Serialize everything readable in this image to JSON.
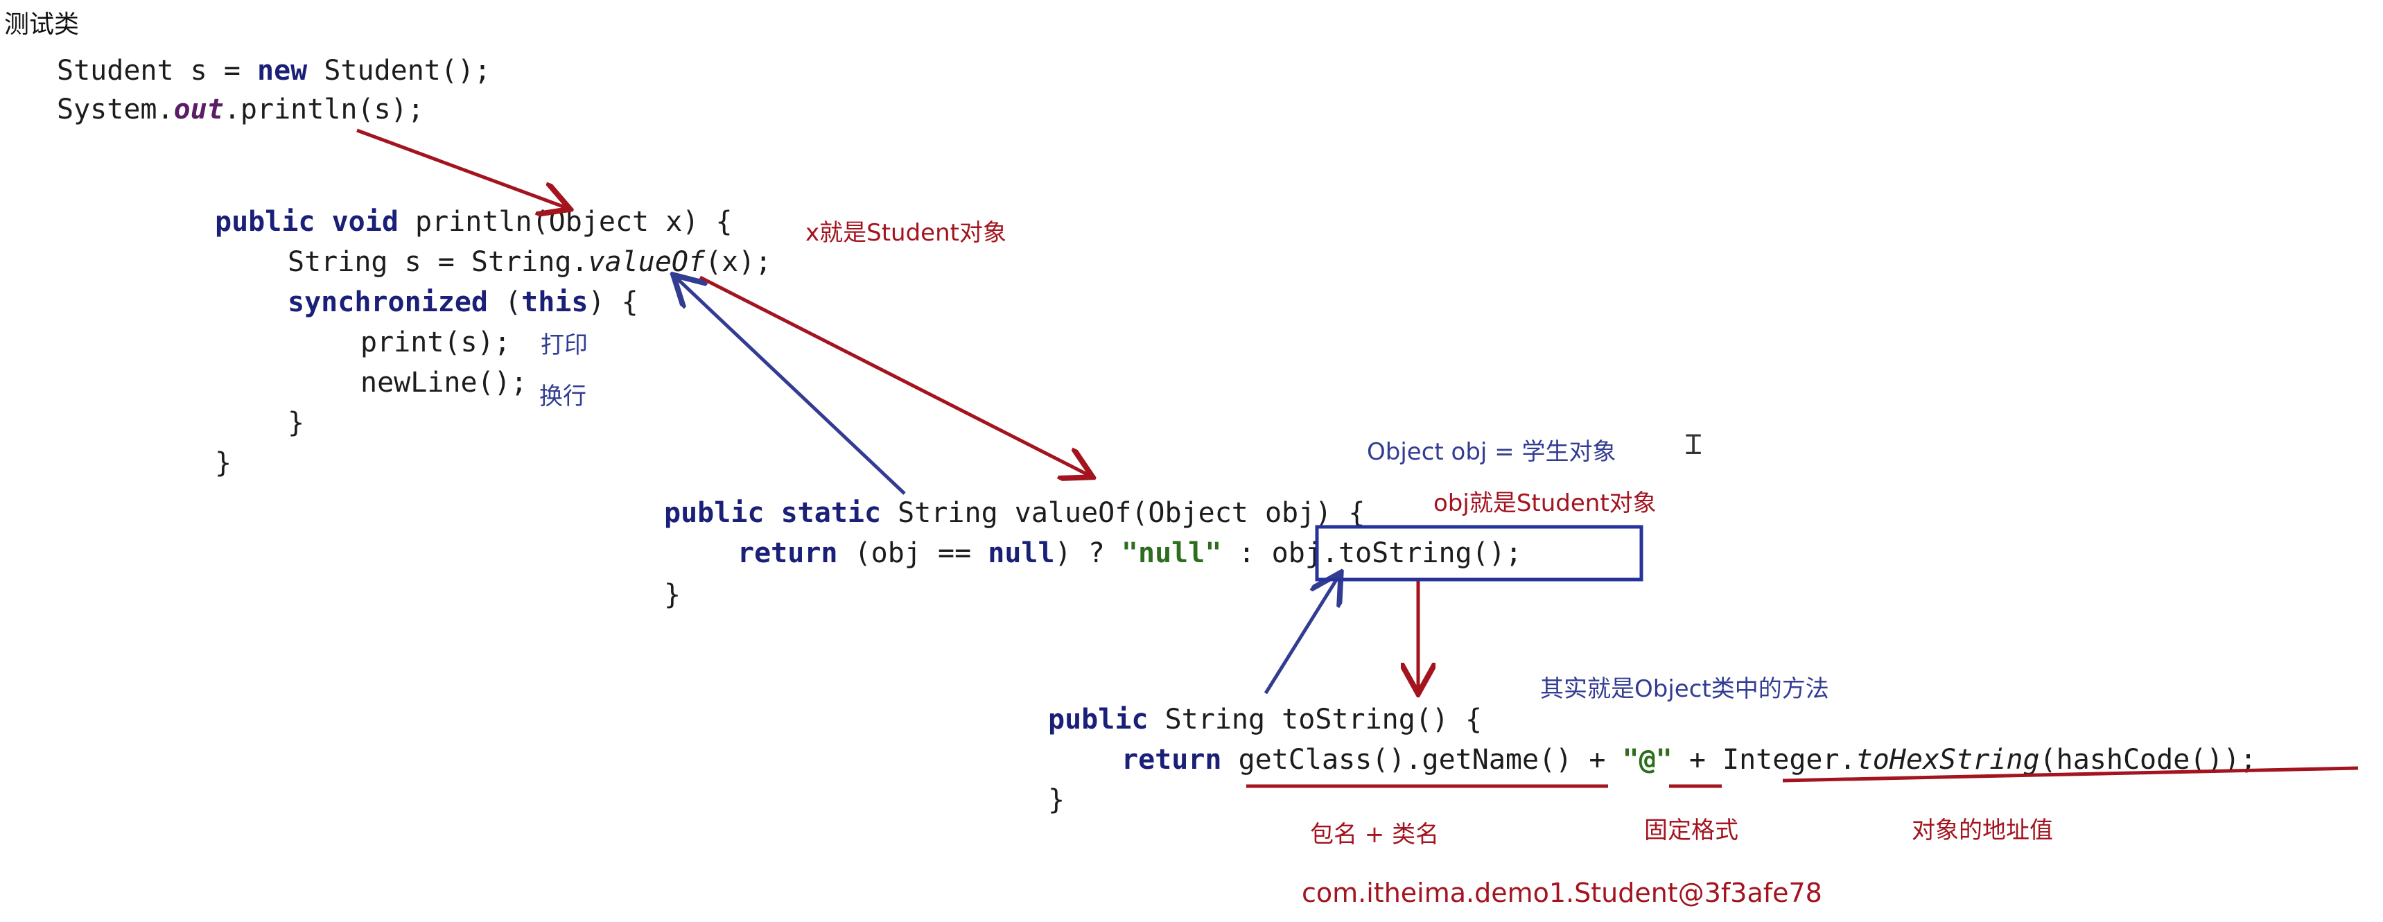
{
  "title": "测试类",
  "test_code": {
    "line1": "Student s = new Student();",
    "line1_pre": "Student s = ",
    "line1_kw": "new",
    "line1_post": " Student();",
    "line2_pre": "System.",
    "line2_out": "out",
    "line2_post": ".println(s);"
  },
  "println_method": {
    "kw": "public void",
    "sig": " println(Object x) {",
    "line2_pre": "String s = String.",
    "line2_italic": "valueOf",
    "line2_post": "(x);",
    "line3_kw1": "synchronized",
    "line3_mid": " (",
    "line3_kw2": "this",
    "line3_post": ") {",
    "line4": "print(s);",
    "line5": "newLine();",
    "line6": "}",
    "line7": "}"
  },
  "valueof_method": {
    "kw": "public static",
    "sig": " String valueOf(Object obj) {",
    "ret_kw": "return",
    "ret_mid1": " (obj == ",
    "ret_null_kw": "null",
    "ret_mid2": ") ? ",
    "ret_str": "\"null\"",
    "ret_mid3": " : ",
    "ret_boxed": "obj.toString();",
    "close": "}"
  },
  "tostring_method": {
    "kw": "public",
    "sig": " String toString() {",
    "ret_kw": "return",
    "ret_part1": " getClass().getName()",
    "ret_plus1": " + ",
    "ret_at": "\"@\"",
    "ret_plus2": " + ",
    "ret_part2": "Integer.",
    "ret_italic": "toHexString",
    "ret_part3": "(hashCode());",
    "close": "}"
  },
  "annotations": {
    "x_is_student": "x就是Student对象",
    "print_note": "打印",
    "newline_note": "换行",
    "object_obj": "Object obj = 学生对象",
    "obj_is_student": "obj就是Student对象",
    "actually_object_method": "其实就是Object类中的方法",
    "package_class": "包名 + 类名",
    "fixed_format": "固定格式",
    "address_value": "对象的地址值",
    "result": "com.itheima.demo1.Student@3f3afe78"
  },
  "colors": {
    "red": "#a3141f",
    "blue": "#323c92",
    "keyword": "#1a1f78",
    "string": "#2d6e1e"
  }
}
